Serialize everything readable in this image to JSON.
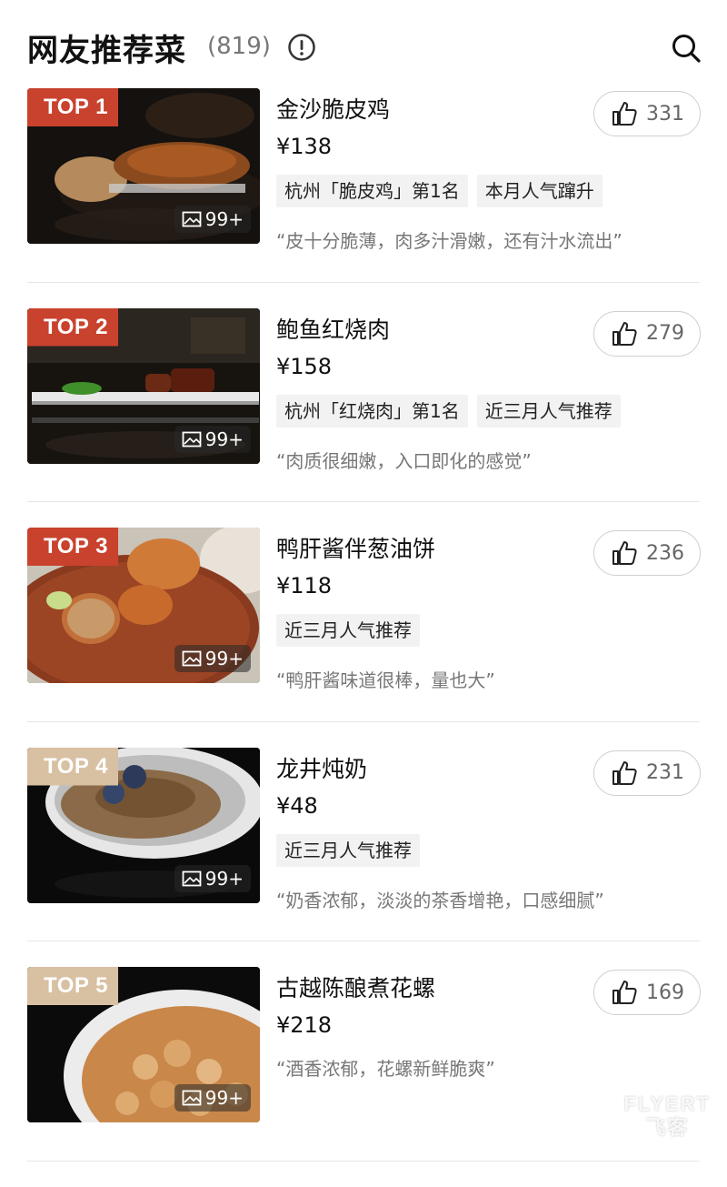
{
  "header": {
    "title": "网友推荐菜",
    "count": "(819)"
  },
  "dishes": [
    {
      "rank": "TOP 1",
      "name": "金沙脆皮鸡",
      "price": "¥138",
      "tags": [
        "杭州「脆皮鸡」第1名",
        "本月人气蹿升"
      ],
      "quote": "“皮十分脆薄，肉多汁滑嫩，还有汁水流出”",
      "likes": "331",
      "photos": "99+"
    },
    {
      "rank": "TOP 2",
      "name": "鲍鱼红烧肉",
      "price": "¥158",
      "tags": [
        "杭州「红烧肉」第1名",
        "近三月人气推荐"
      ],
      "quote": "“肉质很细嫩，入口即化的感觉”",
      "likes": "279",
      "photos": "99+"
    },
    {
      "rank": "TOP 3",
      "name": "鸭肝酱伴葱油饼",
      "price": "¥118",
      "tags": [
        "近三月人气推荐"
      ],
      "quote": "“鸭肝酱味道很棒，量也大”",
      "likes": "236",
      "photos": "99+"
    },
    {
      "rank": "TOP 4",
      "name": "龙井炖奶",
      "price": "¥48",
      "tags": [
        "近三月人气推荐"
      ],
      "quote": "“奶香浓郁，淡淡的茶香增艳，口感细腻”",
      "likes": "231",
      "photos": "99+"
    },
    {
      "rank": "TOP 5",
      "name": "古越陈酿煮花螺",
      "price": "¥218",
      "tags": [],
      "quote": "“酒香浓郁，花螺新鲜脆爽”",
      "likes": "169",
      "photos": "99+"
    }
  ],
  "watermark": {
    "line1": "FLYERT",
    "line2": "飞客"
  },
  "colors": {
    "rank_top": "#c9422d",
    "rank_other": "#d8c0a2",
    "tag_bg": "#f2f2f2",
    "quote_text": "#777777"
  },
  "icons": {
    "info": "info-circle-icon",
    "search": "search-icon",
    "like": "thumbs-up-icon",
    "photo": "image-icon"
  }
}
